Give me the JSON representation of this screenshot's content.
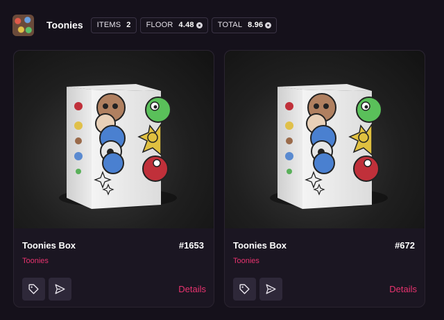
{
  "header": {
    "collection_name": "Toonies",
    "stats": {
      "items_label": "ITEMS",
      "items_value": "2",
      "floor_label": "FLOOR",
      "floor_value": "4.48",
      "total_label": "TOTAL",
      "total_value": "8.96"
    },
    "currency_icon": "coin-icon"
  },
  "cards": [
    {
      "title": "Toonies Box",
      "number": "#1653",
      "collection": "Toonies",
      "details_label": "Details",
      "tag_icon": "tag-icon",
      "send_icon": "send-icon"
    },
    {
      "title": "Toonies Box",
      "number": "#672",
      "collection": "Toonies",
      "details_label": "Details",
      "tag_icon": "tag-icon",
      "send_icon": "send-icon"
    }
  ],
  "colors": {
    "background": "#15111b",
    "card": "#1b1622",
    "accent": "#e8336f",
    "button": "#2e2839"
  }
}
